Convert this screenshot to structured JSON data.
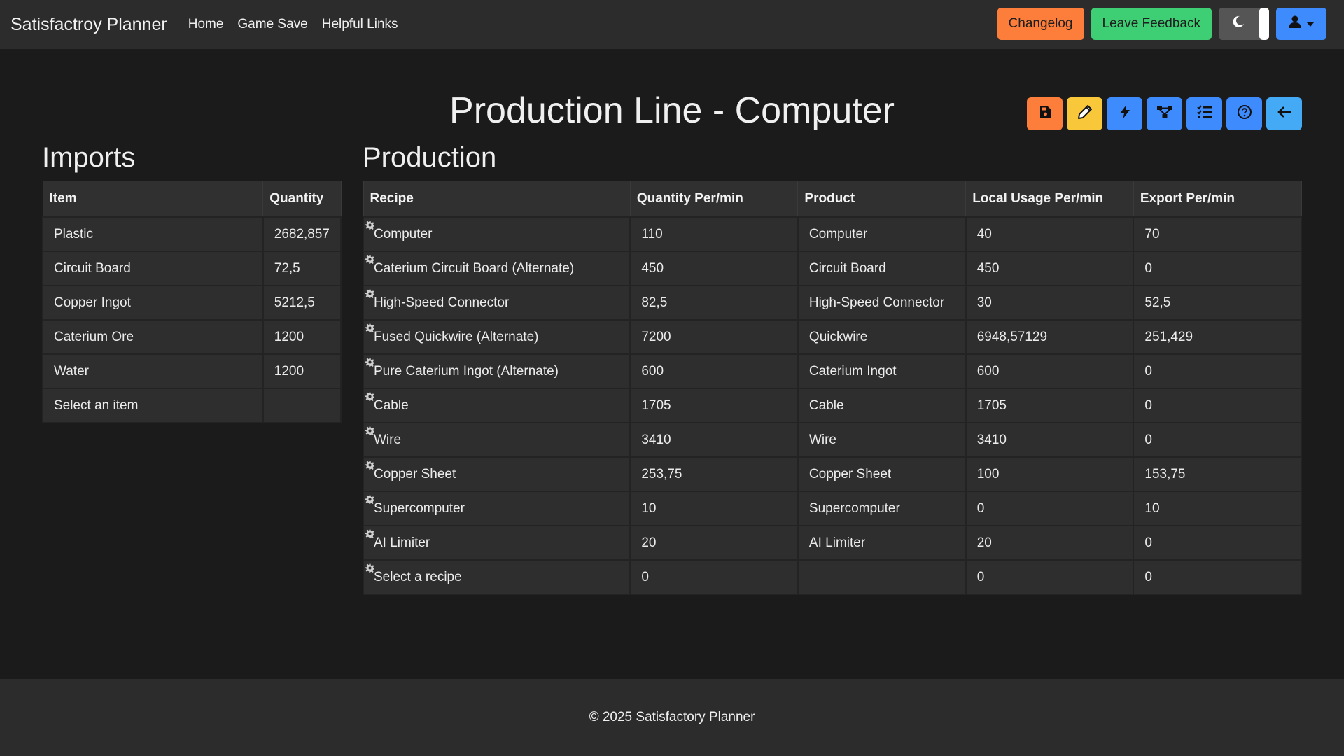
{
  "navbar": {
    "brand": "Satisfactroy Planner",
    "links": [
      "Home",
      "Game Save",
      "Helpful Links"
    ],
    "changelog": "Changelog",
    "feedback": "Leave Feedback"
  },
  "page": {
    "title": "Production Line - Computer"
  },
  "imports": {
    "heading": "Imports",
    "columns": [
      "Item",
      "Quantity"
    ],
    "rows": [
      {
        "item": "Plastic",
        "quantity": "2682,857"
      },
      {
        "item": "Circuit Board",
        "quantity": "72,5"
      },
      {
        "item": "Copper Ingot",
        "quantity": "5212,5"
      },
      {
        "item": "Caterium Ore",
        "quantity": "1200"
      },
      {
        "item": "Water",
        "quantity": "1200"
      },
      {
        "item": "Select an item",
        "quantity": ""
      }
    ]
  },
  "production": {
    "heading": "Production",
    "columns": [
      "Recipe",
      "Quantity Per/min",
      "Product",
      "Local Usage Per/min",
      "Export Per/min"
    ],
    "rows": [
      {
        "recipe": "Computer",
        "qty": "110",
        "product": "Computer",
        "local": "40",
        "export": "70"
      },
      {
        "recipe": "Caterium Circuit Board (Alternate)",
        "qty": "450",
        "product": "Circuit Board",
        "local": "450",
        "export": "0"
      },
      {
        "recipe": "High-Speed Connector",
        "qty": "82,5",
        "product": "High-Speed Connector",
        "local": "30",
        "export": "52,5"
      },
      {
        "recipe": "Fused Quickwire (Alternate)",
        "qty": "7200",
        "product": "Quickwire",
        "local": "6948,57129",
        "export": "251,429"
      },
      {
        "recipe": "Pure Caterium Ingot (Alternate)",
        "qty": "600",
        "product": "Caterium Ingot",
        "local": "600",
        "export": "0"
      },
      {
        "recipe": "Cable",
        "qty": "1705",
        "product": "Cable",
        "local": "1705",
        "export": "0"
      },
      {
        "recipe": "Wire",
        "qty": "3410",
        "product": "Wire",
        "local": "3410",
        "export": "0"
      },
      {
        "recipe": "Copper Sheet",
        "qty": "253,75",
        "product": "Copper Sheet",
        "local": "100",
        "export": "153,75"
      },
      {
        "recipe": "Supercomputer",
        "qty": "10",
        "product": "Supercomputer",
        "local": "0",
        "export": "10"
      },
      {
        "recipe": "AI Limiter",
        "qty": "20",
        "product": "AI Limiter",
        "local": "20",
        "export": "0"
      },
      {
        "recipe": "Select a recipe",
        "qty": "0",
        "product": "",
        "local": "0",
        "export": "0"
      }
    ]
  },
  "footer": {
    "text": "© 2025 Satisfactory Planner"
  },
  "colors": {
    "orange": "#fd7e3a",
    "green": "#3ecf75",
    "yellow": "#f8c83a",
    "blue": "#3d8bfd",
    "cyan": "#44aaf5"
  },
  "icons": [
    "moon-icon",
    "user-icon",
    "save-icon",
    "pencil-icon",
    "bolt-icon",
    "diagram-icon",
    "checklist-icon",
    "help-icon",
    "arrow-left-icon",
    "cog-icon"
  ]
}
